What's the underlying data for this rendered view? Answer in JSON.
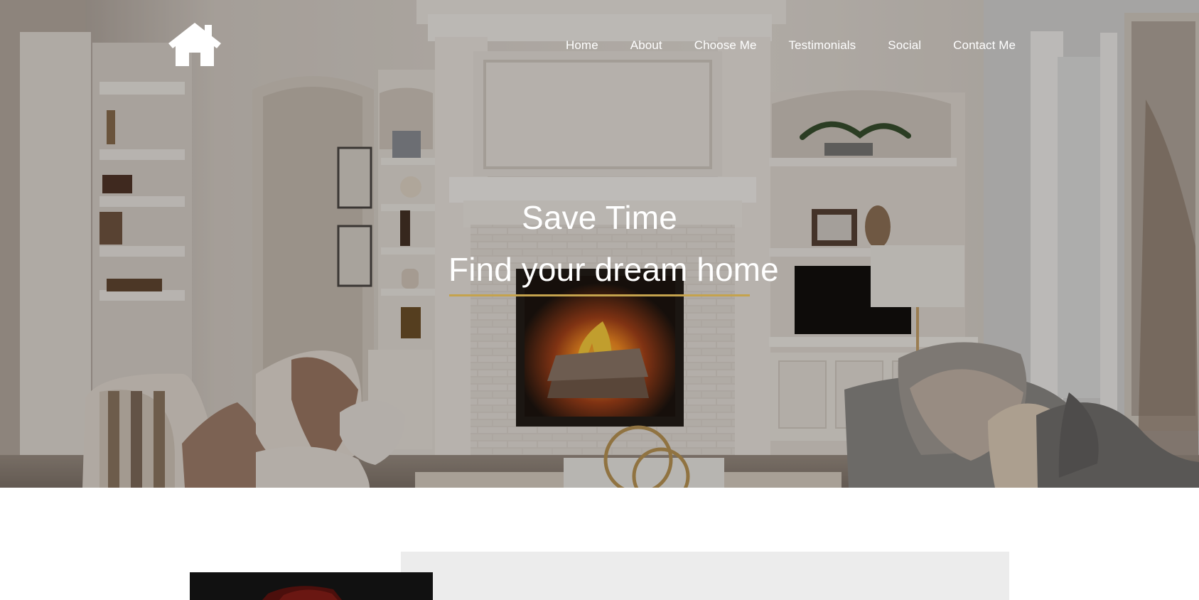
{
  "nav": {
    "items": [
      {
        "label": "Home"
      },
      {
        "label": "About"
      },
      {
        "label": "Choose Me"
      },
      {
        "label": "Testimonials"
      },
      {
        "label": "Social"
      },
      {
        "label": "Contact Me"
      }
    ]
  },
  "hero": {
    "title": "Save Time",
    "subtitle": "Find your dream home"
  },
  "icons": {
    "logo": "house-icon"
  },
  "colors": {
    "accent": "#c5a34d",
    "text": "#ffffff",
    "panel": "#ececec",
    "image_dark": "#111111"
  }
}
